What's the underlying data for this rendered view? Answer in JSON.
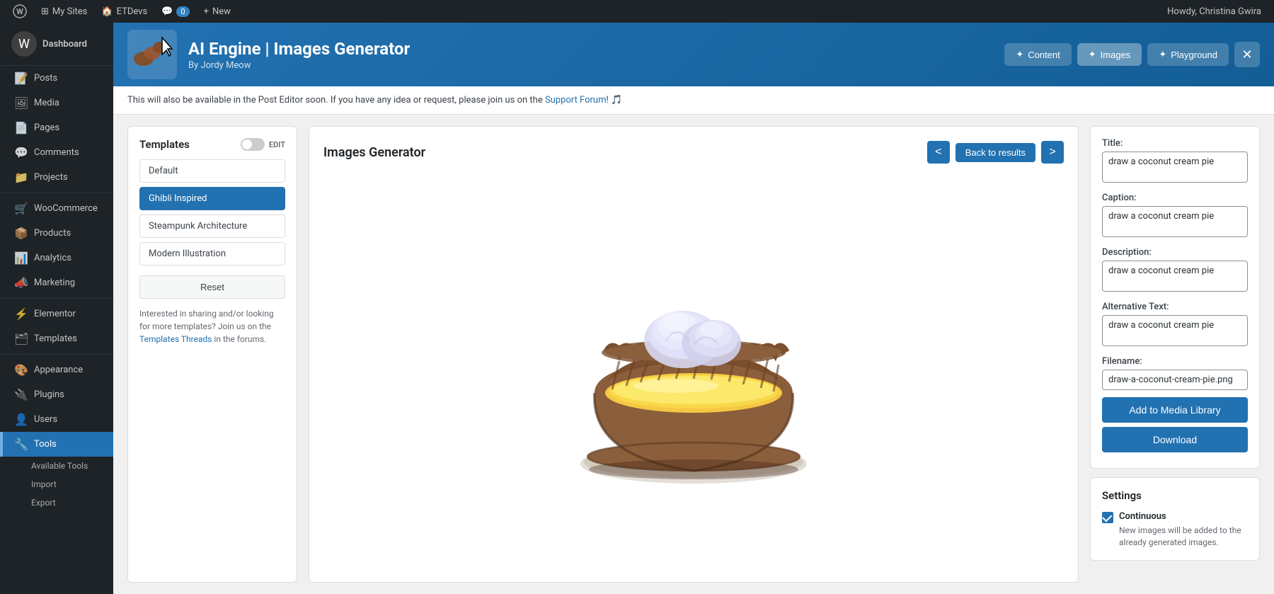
{
  "adminbar": {
    "wp_icon": "W",
    "items": [
      {
        "label": "My Sites",
        "icon": "⊞"
      },
      {
        "label": "ETDevs",
        "icon": "🏠"
      },
      {
        "label": "0",
        "icon": "💬"
      },
      {
        "label": "New",
        "icon": "+"
      }
    ],
    "howdy": "Howdy, Christina Gwira"
  },
  "sidebar": {
    "logo_text": "Dashboard",
    "menu_items": [
      {
        "label": "Posts",
        "icon": "📝",
        "active": false
      },
      {
        "label": "Media",
        "icon": "🖼",
        "active": false
      },
      {
        "label": "Pages",
        "icon": "📄",
        "active": false
      },
      {
        "label": "Comments",
        "icon": "💬",
        "active": false
      },
      {
        "label": "Projects",
        "icon": "📁",
        "active": false
      },
      {
        "label": "WooCommerce",
        "icon": "🛒",
        "active": false
      },
      {
        "label": "Products",
        "icon": "📦",
        "active": false
      },
      {
        "label": "Analytics",
        "icon": "📊",
        "active": false
      },
      {
        "label": "Marketing",
        "icon": "📣",
        "active": false
      },
      {
        "label": "Elementor",
        "icon": "⚡",
        "active": false
      },
      {
        "label": "Templates",
        "icon": "🗂",
        "active": false
      },
      {
        "label": "Appearance",
        "icon": "🎨",
        "active": false
      },
      {
        "label": "Plugins",
        "icon": "🔌",
        "active": false
      },
      {
        "label": "Users",
        "icon": "👤",
        "active": false
      },
      {
        "label": "Tools",
        "icon": "🔧",
        "active": true
      }
    ],
    "submenu_items": [
      {
        "label": "Available Tools",
        "active": false
      },
      {
        "label": "Import",
        "active": false
      },
      {
        "label": "Export",
        "active": false
      }
    ]
  },
  "plugin_header": {
    "title": "AI Engine | Images Generator",
    "subtitle": "By Jordy Meow",
    "nav_buttons": [
      {
        "label": "Content",
        "icon": "✦",
        "active": false
      },
      {
        "label": "Images",
        "icon": "✦",
        "active": true
      },
      {
        "label": "Playground",
        "icon": "✦",
        "active": false
      }
    ],
    "close_icon": "✕"
  },
  "notice": {
    "text": "This will also be available in the Post Editor soon. If you have any idea or request, please join us on the ",
    "link_text": "Support Forum",
    "suffix": "! 🎵"
  },
  "templates": {
    "title": "Templates",
    "toggle_label": "EDIT",
    "items": [
      {
        "label": "Default",
        "active": false
      },
      {
        "label": "Ghibli Inspired",
        "active": true
      },
      {
        "label": "Steampunk Architecture",
        "active": false
      },
      {
        "label": "Modern Illustration",
        "active": false
      }
    ],
    "reset_label": "Reset",
    "footer_text": "Interested in sharing and/or looking for more templates? Join us on the ",
    "footer_link": "Templates Threads",
    "footer_suffix": " in the forums."
  },
  "generator": {
    "title": "Images Generator",
    "back_label": "Back to results",
    "nav_prev": "<",
    "nav_next": ">"
  },
  "fields": {
    "title_label": "Title:",
    "title_value": "draw a coconut cream pie",
    "caption_label": "Caption:",
    "caption_value": "draw a coconut cream pie",
    "description_label": "Description:",
    "description_value": "draw a coconut cream pie",
    "alt_label": "Alternative Text:",
    "alt_value": "draw a coconut cream pie",
    "filename_label": "Filename:",
    "filename_value": "draw-a-coconut-cream-pie.png",
    "add_media_label": "Add to Media Library",
    "download_label": "Download"
  },
  "settings": {
    "title": "Settings",
    "continuous_label": "Continuous",
    "continuous_desc": "New images will be added to the already generated images."
  }
}
